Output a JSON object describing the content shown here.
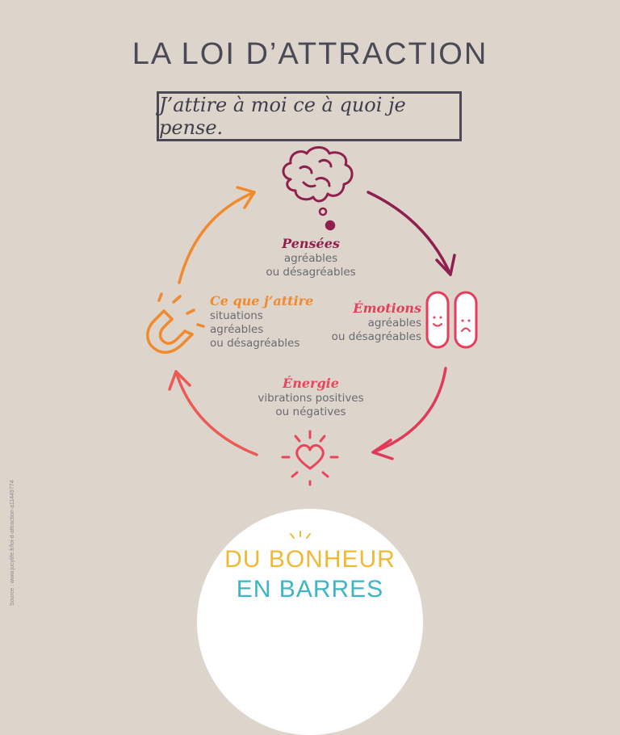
{
  "title": "LA LOI D’ATTRACTION",
  "subtitle": "J’attire à moi ce à quoi je pense.",
  "cycle": {
    "pensees": {
      "title": "Pensées",
      "line1": "agréables",
      "line2": "ou désagréables"
    },
    "emotions": {
      "title": "Émotions",
      "line1": "agréables",
      "line2": "ou désagréables"
    },
    "energie": {
      "title": "Énergie",
      "line1": "vibrations positives",
      "line2": "ou négatives"
    },
    "attire": {
      "title": "Ce que j’attire",
      "line1": "situations",
      "line2": "agréables",
      "line3": "ou désagréables"
    }
  },
  "source": "Source : www.jucylife.fr/loi-d-attraction-a11449774",
  "logo": {
    "line1": "DU BONHEUR",
    "line2": "EN BARRES"
  },
  "colors": {
    "background": "#ddd5cc",
    "pensees": "#8e1f4e",
    "emotions": "#e53e5c",
    "energie": "#e9455b",
    "attire": "#f08a2c",
    "logo_yellow": "#f1b833",
    "logo_blue": "#3db5c6"
  },
  "icons": [
    "brain-icon",
    "thought-bubble-icon",
    "emotion-capsules-icon",
    "radiant-heart-icon",
    "magnet-icon"
  ]
}
